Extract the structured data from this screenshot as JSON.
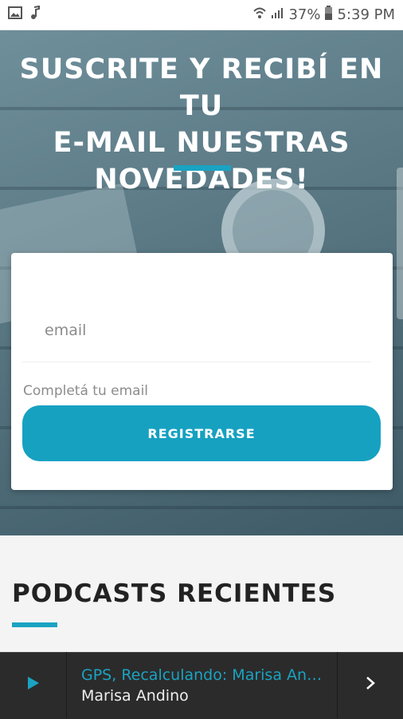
{
  "status_bar": {
    "left_icons": [
      "image-icon",
      "music-note-icon"
    ],
    "right_icons": [
      "wifi-icon",
      "signal-icon",
      "battery-icon"
    ],
    "battery": "37%",
    "time": "5:39 PM"
  },
  "hero": {
    "title": "SUSCRITE Y RECIBÍ EN TU\nE-MAIL NUESTRAS\nNOVEDADES!",
    "accent_color": "#1aa3c2"
  },
  "form": {
    "email_placeholder": "email",
    "email_value": "",
    "helper_text": "Completá tu email",
    "register_label": "REGISTRARSE",
    "button_color": "#16a1c1"
  },
  "section": {
    "title": "PODCASTS RECIENTES"
  },
  "player": {
    "title": "GPS, Recalculando: Marisa Andino",
    "artist": "Marisa Andino",
    "play_icon": "play-icon",
    "next_icon": "chevron-right-icon"
  }
}
